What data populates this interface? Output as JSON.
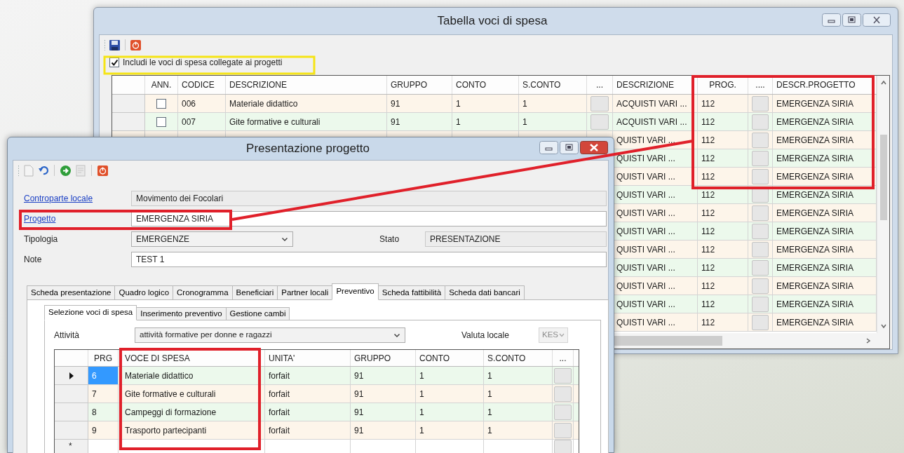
{
  "table_window": {
    "title": "Tabella voci di spesa",
    "include_checkbox": {
      "label": "Includi le voci di spesa collegate ai progetti",
      "checked": true
    },
    "table": {
      "columns": [
        "ANN.",
        "CODICE",
        "DESCRIZIONE",
        "GRUPPO",
        "CONTO",
        "S.CONTO",
        "...",
        "DESCRIZIONE",
        "PROG.",
        "....",
        "DESCR.PROGETTO"
      ],
      "rows": [
        {
          "ann": false,
          "codice": "006",
          "descrizione": "Materiale didattico",
          "gruppo": "91",
          "conto": "1",
          "s_conto": "1",
          "descrizione_2": "ACQUISTI VARI ...",
          "prog": "112",
          "descr_progetto": "EMERGENZA SIRIA"
        },
        {
          "ann": false,
          "codice": "007",
          "descrizione": "Gite formative e culturali",
          "gruppo": "91",
          "conto": "1",
          "s_conto": "1",
          "descrizione_2": "ACQUISTI VARI ...",
          "prog": "112",
          "descr_progetto": "EMERGENZA SIRIA"
        },
        {
          "descrizione_2": "QUISTI VARI ...",
          "prog": "112",
          "descr_progetto": "EMERGENZA SIRIA"
        },
        {
          "descrizione_2": "QUISTI VARI ...",
          "prog": "112",
          "descr_progetto": "EMERGENZA SIRIA"
        },
        {
          "descrizione_2": "QUISTI VARI ...",
          "prog": "112",
          "descr_progetto": "EMERGENZA SIRIA"
        },
        {
          "descrizione_2": "QUISTI VARI ...",
          "prog": "112",
          "descr_progetto": "EMERGENZA SIRIA"
        },
        {
          "descrizione_2": "QUISTI VARI ...",
          "prog": "112",
          "descr_progetto": "EMERGENZA SIRIA"
        },
        {
          "descrizione_2": "QUISTI VARI ...",
          "prog": "112",
          "descr_progetto": "EMERGENZA SIRIA"
        },
        {
          "descrizione_2": "QUISTI VARI ...",
          "prog": "112",
          "descr_progetto": "EMERGENZA SIRIA"
        },
        {
          "descrizione_2": "QUISTI VARI ...",
          "prog": "112",
          "descr_progetto": "EMERGENZA SIRIA"
        },
        {
          "descrizione_2": "QUISTI VARI ...",
          "prog": "112",
          "descr_progetto": "EMERGENZA SIRIA"
        },
        {
          "descrizione_2": "QUISTI VARI ...",
          "prog": "112",
          "descr_progetto": "EMERGENZA SIRIA"
        },
        {
          "descrizione_2": "QUISTI VARI ...",
          "prog": "112",
          "descr_progetto": "EMERGENZA SIRIA"
        }
      ]
    }
  },
  "project_window": {
    "title": "Presentazione progetto",
    "fields": [
      {
        "label": "Controparte locale",
        "link": true,
        "kind": "text",
        "readonly": true,
        "value": "Movimento dei Focolari"
      },
      {
        "label": "Progetto",
        "link": true,
        "kind": "text",
        "readonly": false,
        "value": "EMERGENZA SIRIA"
      },
      {
        "label": "Tipologia",
        "link": false,
        "kind": "select",
        "value": "EMERGENZE"
      },
      {
        "label": "Note",
        "link": false,
        "kind": "text",
        "readonly": false,
        "value": "TEST 1"
      }
    ],
    "stato": {
      "label": "Stato",
      "value": "PRESENTAZIONE"
    },
    "tabs": [
      {
        "label": "Scheda presentazione",
        "selected": false
      },
      {
        "label": "Quadro logico",
        "selected": false
      },
      {
        "label": "Cronogramma",
        "selected": false
      },
      {
        "label": "Beneficiari",
        "selected": false
      },
      {
        "label": "Partner locali",
        "selected": false
      },
      {
        "label": "Preventivo",
        "selected": true
      },
      {
        "label": "Scheda fattibilità",
        "selected": false
      },
      {
        "label": "Scheda dati bancari",
        "selected": false
      }
    ],
    "subtabs": [
      {
        "label": "Selezione voci di spesa",
        "selected": true
      },
      {
        "label": "Inserimento preventivo",
        "selected": false
      },
      {
        "label": "Gestione cambi",
        "selected": false
      }
    ],
    "attivita": {
      "label": "Attività",
      "value": "attività formative per donne e ragazzi"
    },
    "valuta": {
      "label": "Valuta locale",
      "value": "KES",
      "disabled": true
    },
    "grid": {
      "columns": [
        "PRG",
        "VOCE DI SPESA",
        "UNITA'",
        "GRUPPO",
        "CONTO",
        "S.CONTO",
        "..."
      ],
      "rows": [
        {
          "selected": true,
          "prg": "6",
          "voce": "Materiale didattico",
          "unita": "forfait",
          "gruppo": "91",
          "conto": "1",
          "s_conto": "1"
        },
        {
          "selected": false,
          "prg": "7",
          "voce": "Gite formative e culturali",
          "unita": "forfait",
          "gruppo": "91",
          "conto": "1",
          "s_conto": "1"
        },
        {
          "selected": false,
          "prg": "8",
          "voce": "Campeggi di formazione",
          "unita": "forfait",
          "gruppo": "91",
          "conto": "1",
          "s_conto": "1"
        },
        {
          "selected": false,
          "prg": "9",
          "voce": "Trasporto partecipanti",
          "unita": "forfait",
          "gruppo": "91",
          "conto": "1",
          "s_conto": "1"
        }
      ],
      "new_row_marker": "*"
    }
  }
}
